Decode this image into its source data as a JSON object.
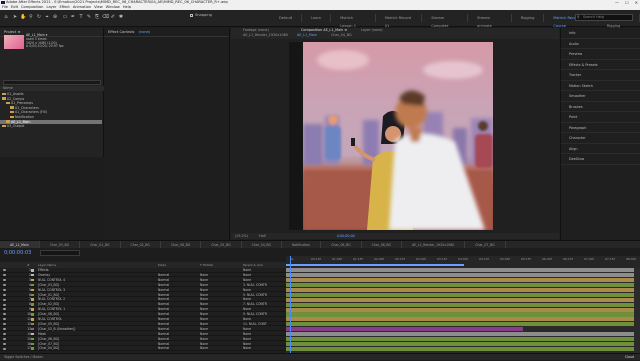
{
  "app": {
    "title": "Adobe After Effects 2021 - E:\\Emotion\\2021 Projects\\MIMD_REC_06_CHARACTER\\04_AE\\MIMD_REC_06_CHARACTER_R+.aep",
    "window_controls": [
      "—",
      "☐",
      "✕"
    ]
  },
  "menu": [
    "File",
    "Edit",
    "Composition",
    "Layer",
    "Effect",
    "Animation",
    "View",
    "Window",
    "Help"
  ],
  "toolbar": {
    "snapping_label": "Snapping",
    "workspaces": [
      "Default",
      "Learn",
      "Mstrick Lesson 1",
      "Mstrick Record 01",
      "Stream Complete",
      "Stream animate",
      "Rigging",
      "Mstrick Record Course",
      "Course Rigging"
    ],
    "active_workspace_index": 7,
    "search_placeholder": "Search Help"
  },
  "project": {
    "tab_label": "Project ≡",
    "item_name": "AE_L1_Main ▾",
    "item_info": [
      "used 3 times",
      "1920 x 1080 (1.00)",
      "Δ 0;00;10;00, 29.97 fps"
    ],
    "column_header": "Name",
    "tree": [
      {
        "label": "01_Assets",
        "indent": 2,
        "selected": false
      },
      {
        "label": "02_Comps",
        "indent": 2,
        "selected": false
      },
      {
        "label": "01_Precomps",
        "indent": 6,
        "selected": false
      },
      {
        "label": "01_Characters",
        "indent": 10,
        "selected": false
      },
      {
        "label": "01_Characters (Fill)",
        "indent": 10,
        "selected": false
      },
      {
        "label": "Notification",
        "indent": 10,
        "selected": false
      },
      {
        "label": "AE_L1_Main",
        "indent": 6,
        "selected": true
      },
      {
        "label": "03_Output",
        "indent": 2,
        "selected": false
      }
    ]
  },
  "effect_controls": {
    "tab_label": "Effect Controls",
    "tab_item": "(none)"
  },
  "viewer": {
    "tabs": [
      "Footage (none)",
      "Composition AE_L1_Main ≡",
      "Layer (none)"
    ],
    "sub_tabs": [
      "AE_L1_Render_1920x1080",
      "AE_L1_Main",
      "Char_04_BG"
    ],
    "zoom": "(19.2%)",
    "resolution": "Half",
    "timecode": "0;00;00;00"
  },
  "right_panel": {
    "items": [
      "Info",
      "Audio",
      "Preview",
      "Effects & Presets",
      "Tracker",
      "Motion Sketch",
      "Smoother",
      "Brushes",
      "Paint",
      "Paragraph",
      "Character",
      "Align",
      "DeeGlow"
    ]
  },
  "timeline": {
    "tabs": [
      "AE_L1_Main",
      "Char_03_BG",
      "Char_01_BG",
      "Char_02_BG",
      "Char_08_BG",
      "Char_05_BG",
      "Char_04_BG",
      "Notification",
      "Char_06_BG",
      "Char_06_BG",
      "AE_L1_Render_1920x1080",
      "Char_07_BG"
    ],
    "timecode": "0;00:00:03",
    "header": {
      "cols": [
        "#",
        "Layer Name",
        "Mode",
        "T TrkMat",
        "Parent & Link"
      ]
    },
    "ruler_marks": [
      "0s",
      "00:15f",
      "01:00f",
      "01:15f",
      "02:00f",
      "02:15f",
      "03:00f",
      "03:15f",
      "04:00f",
      "04:15f",
      "05:00f",
      "05:15f",
      "06:00f",
      "06:15f",
      "07:00f",
      "07:15f",
      "08:00f"
    ],
    "layers": [
      {
        "num": "1",
        "name": "Effects",
        "mode": "",
        "trk": "",
        "parent": "None",
        "color": "#b9b9b9",
        "bar": "#8d8d8d",
        "start": 0,
        "end": 100
      },
      {
        "num": "2",
        "name": "Overlay",
        "mode": "Normal",
        "trk": "None",
        "parent": "None",
        "color": "#b9b9b9",
        "bar": "#8d8d8d",
        "start": 0,
        "end": 100
      },
      {
        "num": "3",
        "name": "NULL CONTROL 4",
        "mode": "Normal",
        "trk": "None",
        "parent": "None",
        "color": "#c4a35a",
        "bar": "#a88a4a",
        "start": 0,
        "end": 100
      },
      {
        "num": "4",
        "name": "[Char_03_BG]",
        "mode": "Normal",
        "trk": "None",
        "parent": "3. NULL CONTR",
        "color": "#6b9b3b",
        "bar": "#6f8f3a",
        "start": 0,
        "end": 100
      },
      {
        "num": "5",
        "name": "NULL CONTROL 3",
        "mode": "Normal",
        "trk": "None",
        "parent": "None",
        "color": "#c4a35a",
        "bar": "#a88a4a",
        "start": 0,
        "end": 100
      },
      {
        "num": "6",
        "name": "[Char_01_BG]",
        "mode": "Normal",
        "trk": "None",
        "parent": "5. NULL CONTR",
        "color": "#6b9b3b",
        "bar": "#6f8f3a",
        "start": 0,
        "end": 100
      },
      {
        "num": "7",
        "name": "NULL CONTROL 2",
        "mode": "Normal",
        "trk": "None",
        "parent": "None",
        "color": "#c4a35a",
        "bar": "#a88a4a",
        "start": 0,
        "end": 100
      },
      {
        "num": "8",
        "name": "[Char_02_BG]",
        "mode": "Normal",
        "trk": "None",
        "parent": "7. NULL CONTR",
        "color": "#6b9b3b",
        "bar": "#6f8f3a",
        "start": 0,
        "end": 100
      },
      {
        "num": "9",
        "name": "NULL CONTROL 1",
        "mode": "Normal",
        "trk": "None",
        "parent": "None",
        "color": "#c4a35a",
        "bar": "#a88a4a",
        "start": 0,
        "end": 100
      },
      {
        "num": "10",
        "name": "[Char_08_BG]",
        "mode": "Normal",
        "trk": "None",
        "parent": "9. NULL CONTR",
        "color": "#6b9b3b",
        "bar": "#6f8f3a",
        "start": 0,
        "end": 100
      },
      {
        "num": "11",
        "name": "NULL CONTROL",
        "mode": "Normal",
        "trk": "None",
        "parent": "None",
        "color": "#c4a35a",
        "bar": "#a88a4a",
        "start": 0,
        "end": 100
      },
      {
        "num": "12",
        "name": "[Char_05_BG]",
        "mode": "Normal",
        "trk": "None",
        "parent": "11. NULL CONT",
        "color": "#6b9b3b",
        "bar": "#6f8f3a",
        "start": 0,
        "end": 100
      },
      {
        "num": "13",
        "name": "[Char_02_B (Smoother)]",
        "mode": "Normal",
        "trk": "None",
        "parent": "None",
        "color": "#a04aa0",
        "bar": "#8a3e8a",
        "start": 0,
        "end": 68
      },
      {
        "num": "14",
        "name": "Mask",
        "mode": "Normal",
        "trk": "None",
        "parent": "None",
        "color": "#b9b9b9",
        "bar": "#8d8d8d",
        "start": 0,
        "end": 100
      },
      {
        "num": "15",
        "name": "[Char_06_BG]",
        "mode": "Normal",
        "trk": "None",
        "parent": "None",
        "color": "#6b9b3b",
        "bar": "#6f8f3a",
        "start": 0,
        "end": 100
      },
      {
        "num": "16",
        "name": "[Char_07_BG]",
        "mode": "Normal",
        "trk": "None",
        "parent": "None",
        "color": "#6b9b3b",
        "bar": "#6f8f3a",
        "start": 0,
        "end": 100
      },
      {
        "num": "17",
        "name": "[Char_04_BG]",
        "mode": "Normal",
        "trk": "None",
        "parent": "None",
        "color": "#6b9b3b",
        "bar": "#6f8f3a",
        "start": 0,
        "end": 100
      }
    ]
  },
  "bottom": {
    "label": "Toggle Switches / Modes",
    "watermark": "Cloud"
  }
}
